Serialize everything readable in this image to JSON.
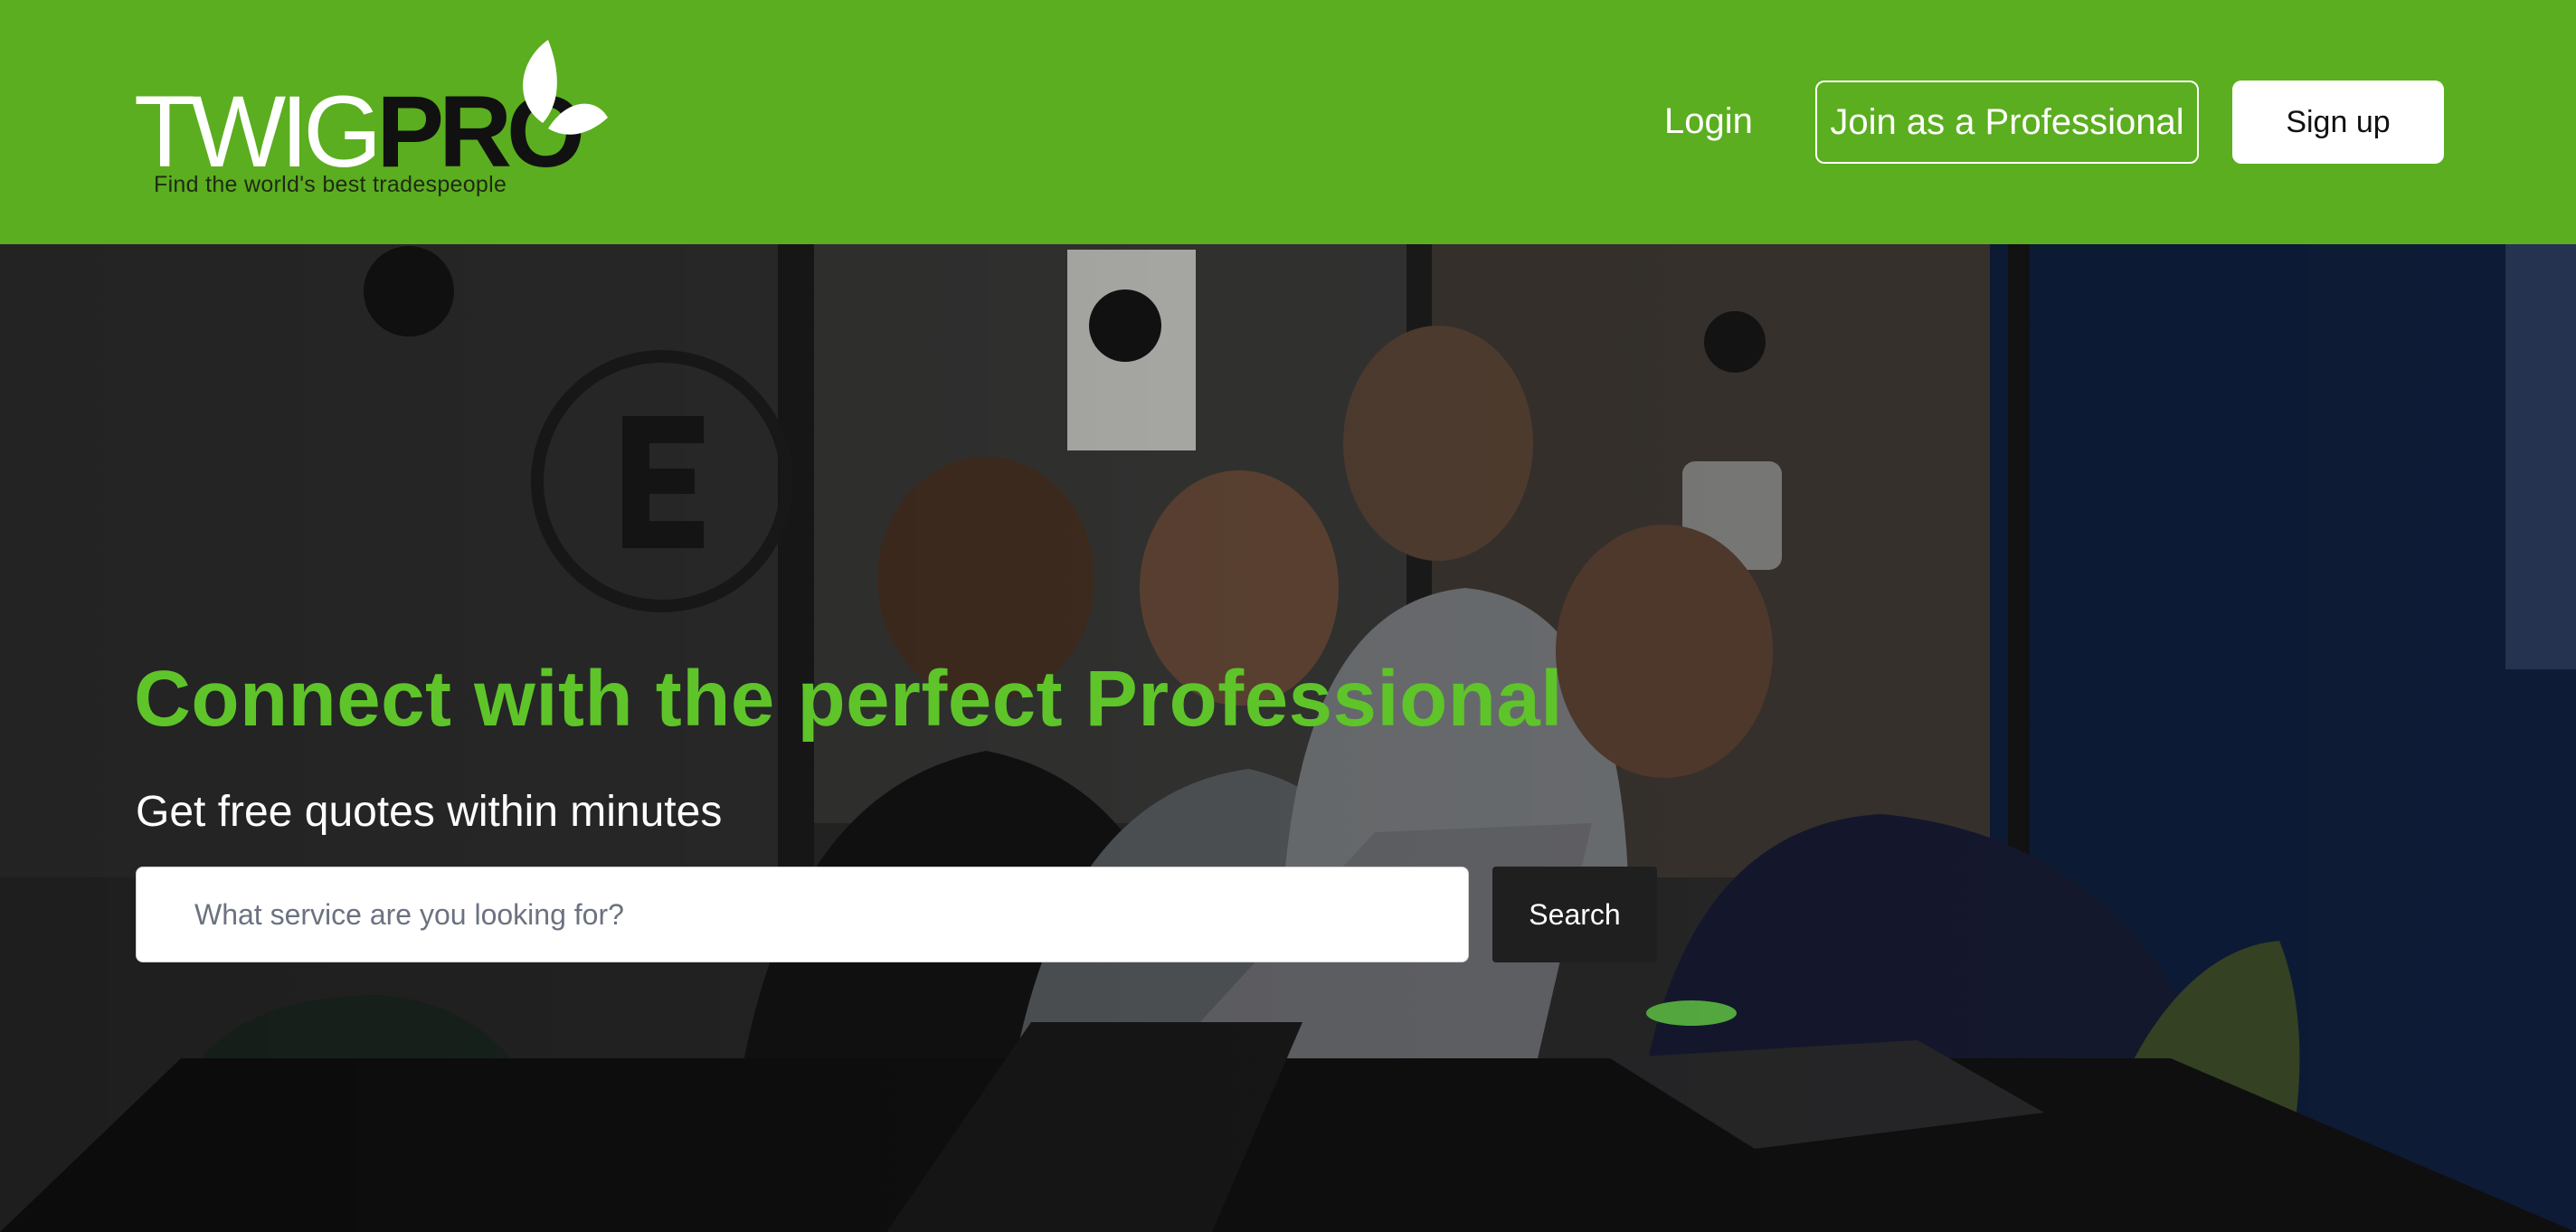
{
  "brand": {
    "logo_twig": "TWIG",
    "logo_pro": "PRO",
    "tagline": "Find the world's best tradespeople",
    "primary_color": "#5bae1f",
    "headline_color": "#5ec42a"
  },
  "nav": {
    "login_label": "Login",
    "join_label": "Join as a Professional",
    "signup_label": "Sign up"
  },
  "hero": {
    "title": "Connect with the perfect Professional",
    "subtitle": "Get free quotes within minutes",
    "search": {
      "value": "",
      "placeholder": "What service are you looking for?",
      "button_label": "Search"
    },
    "background_image": "team-around-laptop-photo"
  }
}
